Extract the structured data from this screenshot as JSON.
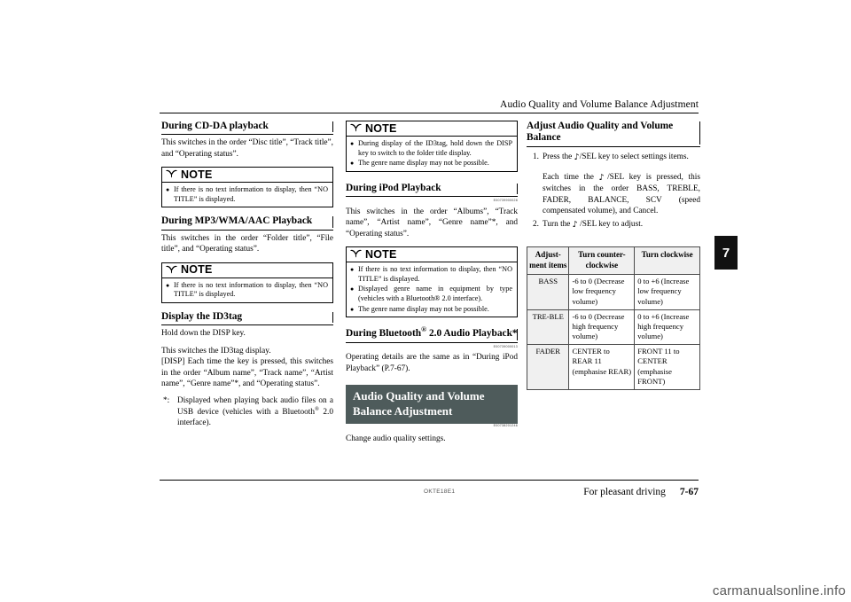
{
  "header": {
    "running_title": "Audio Quality and Volume Balance Adjustment"
  },
  "footer": {
    "doc_code": "OKTE18E1",
    "section_title": "For pleasant driving",
    "page_number": "7-67",
    "chapter_tab": "7",
    "watermark": "carmanualsonline.info"
  },
  "note_label": "NOTE",
  "column1": {
    "h1": "During CD-DA playback",
    "p1": "This switches in the order “Disc title”, “Track title”, and “Operating status”.",
    "note1_items": [
      "If there is no text information to display, then “NO TITLE” is displayed."
    ],
    "h2": "During MP3/WMA/AAC Playback",
    "p2": "This switches in the order “Folder title”, “File title”, and “Operating status”.",
    "note2_items": [
      "If there is no text information to display, then “NO TITLE” is displayed."
    ],
    "h3": "Display the ID3tag",
    "p3": "Hold down the DISP key.",
    "p4": "This switches the ID3tag display.",
    "p5": "[DISP] Each time the key is pressed, this switches in the order “Album name”, “Track name”, “Artist name”, “Genre name”*, and “Operating status”.",
    "footnote_marker": "*:",
    "footnote_text_a": "Displayed when playing back audio files on a USB device (vehicles with a Bluetooth",
    "footnote_sup": "®",
    "footnote_text_b": " 2.0 interface)."
  },
  "column2": {
    "note1_items": [
      "During display of the ID3tag, hold down the DISP key to switch to the folder title display.",
      "The genre name display may not be possible."
    ],
    "h1": "During iPod Playback",
    "h1_code": "E00739900028",
    "p1": "This switches in the order “Albums”, “Track name”, “Artist name”, “Genre name”*, and “Operating status”.",
    "note2_items": [
      "If there is no text information to display, then “NO TITLE” is displayed.",
      "Displayed genre name in equipment by type (vehicles with a Bluetooth® 2.0 interface).",
      "The genre name display may not be possible."
    ],
    "h2_a": "During Bluetooth",
    "h2_sup": "®",
    "h2_b": " 2.0 Audio Playback*",
    "h2_code": "E00739000013",
    "p2": "Operating details are the same as in “During iPod Playback” (P.7-67).",
    "banner": "Audio Quality and Volume Balance Adjustment",
    "banner_code": "E00738201246",
    "p3": "Change audio quality settings."
  },
  "column3": {
    "h1": "Adjust Audio Quality and Volume Balance",
    "step1_num": "1.",
    "step1_a": "Press the",
    "step1_glyph": "♪",
    "step1_b": "/SEL key to select settings items.",
    "para_a": "Each time the",
    "para_glyph": "♪",
    "para_b": "/SEL key is pressed, this switches in the order BASS, TREBLE, FADER, BALANCE, SCV (speed compensated volume), and Cancel.",
    "step2_num": "2.",
    "step2_a": "Turn the",
    "step2_glyph": "♪",
    "step2_b": "/SEL key to adjust.",
    "table": {
      "headers": [
        "Adjust-ment items",
        "Turn counter-clockwise",
        "Turn clockwise"
      ],
      "rows": [
        {
          "item": "BASS",
          "ccw": "-6 to 0 (Decrease low frequency volume)",
          "cw": "0 to +6 (Increase low frequency volume)"
        },
        {
          "item": "TRE-BLE",
          "ccw": "-6 to 0 (Decrease high frequency volume)",
          "cw": "0 to +6 (Increase high frequency volume)"
        },
        {
          "item": "FADER",
          "ccw": "CENTER to REAR 11 (emphasise REAR)",
          "cw": "FRONT 11 to CENTER (emphasise FRONT)"
        }
      ]
    }
  }
}
